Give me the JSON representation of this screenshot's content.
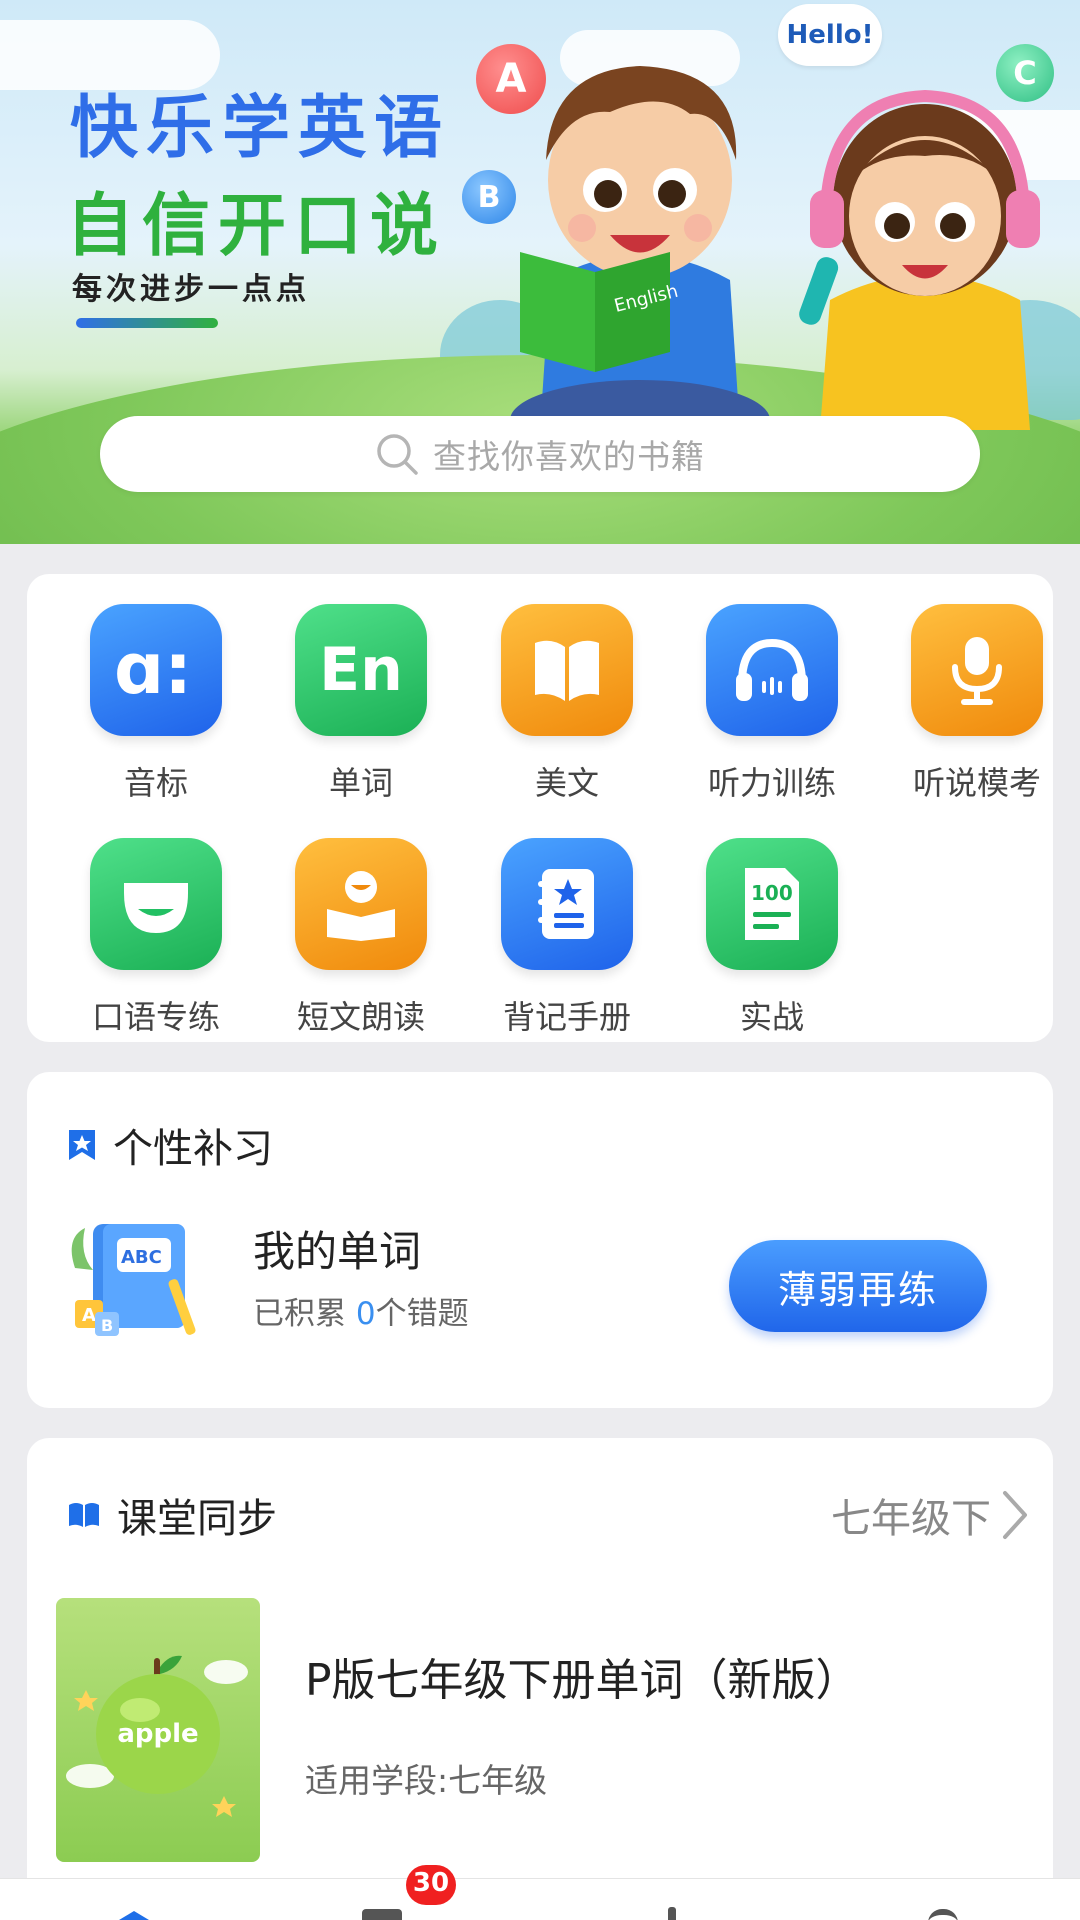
{
  "banner": {
    "slogan_main": "快乐学英语",
    "slogan_second": "自信开口说",
    "slogan_tagline": "每次进步一点点",
    "speech_bubble": "Hello!",
    "letter_a": "A",
    "letter_b": "B",
    "letter_c": "C",
    "book_label": "English"
  },
  "search": {
    "placeholder": "查找你喜欢的书籍",
    "icon": "search-icon"
  },
  "functions": [
    {
      "label": "音标",
      "icon": "phonetic-icon",
      "color": "#2a7af0"
    },
    {
      "label": "单词",
      "icon": "en-icon",
      "color": "#22c063",
      "icon_text": "En"
    },
    {
      "label": "美文",
      "icon": "open-book-icon",
      "color": "#f5a123"
    },
    {
      "label": "听力训练",
      "icon": "headphones-icon",
      "color": "#2a7af0"
    },
    {
      "label": "听说模考",
      "icon": "microphone-icon",
      "color": "#f5a123"
    },
    {
      "label": "口语专练",
      "icon": "mouth-icon",
      "color": "#22c063"
    },
    {
      "label": "短文朗读",
      "icon": "reader-icon",
      "color": "#f5a123"
    },
    {
      "label": "背记手册",
      "icon": "notebook-star-icon",
      "color": "#2a7af0"
    },
    {
      "label": "实战",
      "icon": "exam-paper-icon",
      "color": "#22c063",
      "icon_text": "100"
    }
  ],
  "review": {
    "title": "个性补习",
    "item_title": "我的单词",
    "item_sub_prefix": "已积累 ",
    "item_count": "0",
    "item_sub_suffix": "个错题",
    "button": "薄弱再练"
  },
  "sync": {
    "title": "课堂同步",
    "grade": "七年级下",
    "book_title": "P版七年级下册单词（新版）",
    "book_meta": "适用学段:七年级",
    "cover_word": "apple"
  },
  "tabbar": {
    "badge": "30"
  }
}
